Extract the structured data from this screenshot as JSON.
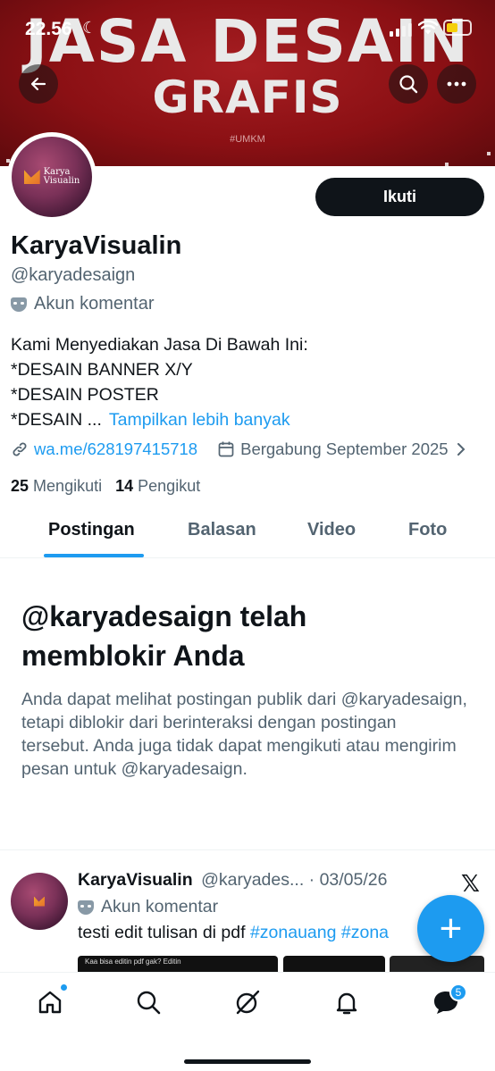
{
  "status_bar": {
    "time": "22.56",
    "moon": "☾"
  },
  "banner": {
    "title_line1": "JASA DESAIN",
    "title_line2": "GRAFIS",
    "hashtag": "#UMKM"
  },
  "avatar": {
    "logo_text_line1": "Karya",
    "logo_text_line2": "Visualin"
  },
  "profile": {
    "follow_label": "Ikuti",
    "display_name": "KaryaVisualin",
    "handle": "@karyadesaign",
    "account_type": "Akun komentar",
    "bio_lines": [
      "Kami Menyediakan Jasa Di Bawah Ini:",
      "*DESAIN BANNER X/Y",
      "*DESAIN POSTER",
      "*DESAIN ..."
    ],
    "show_more": "Tampilkan lebih banyak",
    "link": "wa.me/628197415718",
    "joined": "Bergabung September 2025",
    "following_count": "25",
    "following_label": "Mengikuti",
    "followers_count": "14",
    "followers_label": "Pengikut"
  },
  "tabs": [
    {
      "label": "Postingan",
      "active": true
    },
    {
      "label": "Balasan",
      "active": false
    },
    {
      "label": "Video",
      "active": false
    },
    {
      "label": "Foto",
      "active": false
    }
  ],
  "blocked": {
    "title": "@karyadesaign telah memblokir Anda",
    "body": "Anda dapat melihat postingan publik dari @karyadesaign, tetapi diblokir dari berinteraksi dengan postingan tersebut. Anda juga tidak dapat mengikuti atau mengirim pesan untuk @karyadesaign."
  },
  "post": {
    "name": "KaryaVisualin",
    "handle_date": "@karyades... · 03/05/26",
    "account_type": "Akun komentar",
    "text": "testi edit tulisan di pdf ",
    "tag1": "#zonauang",
    "tag2": "#zona",
    "media_caption": "Kaa bisa editin pdf gak? Editin"
  },
  "fab_label": "+",
  "bottom_nav": {
    "messages_badge": "5"
  },
  "colors": {
    "accent": "#1d9bf0",
    "text": "#0f1419",
    "muted": "#536471",
    "banner": "#8b1014"
  }
}
